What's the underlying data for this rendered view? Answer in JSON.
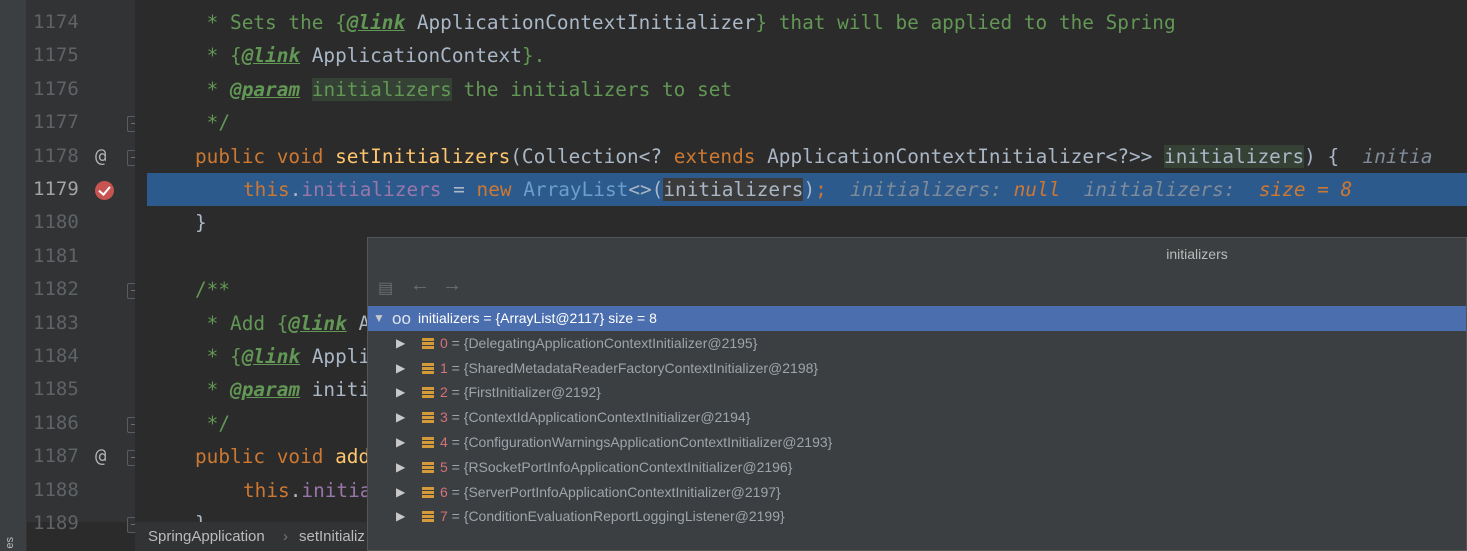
{
  "side_tab": "es",
  "gutter": {
    "lines": [
      "1174",
      "1175",
      "1176",
      "1177",
      "1178",
      "1179",
      "1180",
      "1181",
      "1182",
      "1183",
      "1184",
      "1185",
      "1186",
      "1187",
      "1188",
      "1189"
    ],
    "override_marker": "@"
  },
  "code": {
    "l1174": {
      "a": " * Sets the {",
      "tag": "@link",
      "b": " ApplicationContextInitializer",
      "c": "} that will be applied to the Spring"
    },
    "l1175": {
      "a": " * {",
      "tag": "@link",
      "b": " ApplicationContext",
      "c": "}."
    },
    "l1176": {
      "a": " * ",
      "tag": "@param",
      "p": "initializers",
      "c": " the initializers to set"
    },
    "l1177": {
      "a": " */"
    },
    "l1178": {
      "kw1": "public",
      "kw2": "void",
      "fn": "setInitializers",
      "a": "(Collection<? ",
      "kw3": "extends",
      "b": " ApplicationContextInitializer<?>> ",
      "p": "initializers",
      "c": ") {",
      "hint": "initia"
    },
    "l1179": {
      "kw": "this",
      "dot": ".",
      "fld": "initializers",
      "eq": " = ",
      "kw2": "new",
      "ty": "ArrayList",
      "op": "<>(",
      "p": "initializers",
      "cl": ")",
      "semi": ";",
      "h1": "initializers:",
      "h1v": "null",
      "h2": "initializers:",
      "h2v": "size = 8"
    },
    "l1180": {
      "a": "}"
    },
    "l1182": {
      "a": "/**"
    },
    "l1183": {
      "a": " * Add {",
      "tag": "@link",
      "b": " A"
    },
    "l1184": {
      "a": " * {",
      "tag": "@link",
      "b": " Appli"
    },
    "l1185": {
      "a": " * ",
      "tag": "@param",
      "b": " initi"
    },
    "l1186": {
      "a": " */"
    },
    "l1187": {
      "kw1": "public",
      "kw2": "void",
      "fn": "add"
    },
    "l1188": {
      "kw": "this",
      "dot": ".",
      "fld": "initia"
    },
    "l1189": {
      "a": "}"
    }
  },
  "breadcrumb": {
    "class": "SpringApplication",
    "sep": "›",
    "method": "setInitializ"
  },
  "popup": {
    "title": "initializers",
    "root": {
      "name": "initializers",
      "eq": " = ",
      "value": "{ArrayList@2117}",
      "size": "size = 8"
    },
    "items": [
      {
        "index": "0",
        "value": "{DelegatingApplicationContextInitializer@2195}"
      },
      {
        "index": "1",
        "value": "{SharedMetadataReaderFactoryContextInitializer@2198}"
      },
      {
        "index": "2",
        "value": "{FirstInitializer@2192}"
      },
      {
        "index": "3",
        "value": "{ContextIdApplicationContextInitializer@2194}"
      },
      {
        "index": "4",
        "value": "{ConfigurationWarningsApplicationContextInitializer@2193}"
      },
      {
        "index": "5",
        "value": "{RSocketPortInfoApplicationContextInitializer@2196}"
      },
      {
        "index": "6",
        "value": "{ServerPortInfoApplicationContextInitializer@2197}"
      },
      {
        "index": "7",
        "value": "{ConditionEvaluationReportLoggingListener@2199}"
      }
    ]
  }
}
